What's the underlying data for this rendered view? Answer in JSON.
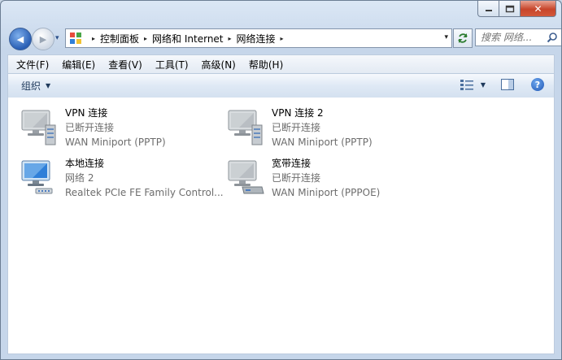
{
  "window": {
    "caption": {
      "minimize_icon": "minimize-icon",
      "maximize_icon": "maximize-icon",
      "close_label": "✕"
    }
  },
  "nav": {
    "back_glyph": "◀",
    "forward_glyph": "▶",
    "dropdown_glyph": "▾"
  },
  "address": {
    "crumbs": [
      "控制面板",
      "网络和 Internet",
      "网络连接"
    ],
    "arrow": "▸",
    "drop": "▾"
  },
  "search": {
    "placeholder": "搜索 网络..."
  },
  "menubar": {
    "items": [
      "文件(F)",
      "编辑(E)",
      "查看(V)",
      "工具(T)",
      "高级(N)",
      "帮助(H)"
    ]
  },
  "commandbar": {
    "organize_label": "组织",
    "organize_arrow": "▼",
    "views_arrow": "▼",
    "help_glyph": "?"
  },
  "connections": [
    {
      "name": "VPN 连接",
      "status": "已断开连接",
      "device": "WAN Miniport (PPTP)",
      "icon": "vpn-connection-icon"
    },
    {
      "name": "VPN 连接 2",
      "status": "已断开连接",
      "device": "WAN Miniport (PPTP)",
      "icon": "vpn-connection-icon"
    },
    {
      "name": "本地连接",
      "status": "网络  2",
      "device": "Realtek PCIe FE Family Control...",
      "icon": "lan-connection-icon"
    },
    {
      "name": "宽带连接",
      "status": "已断开连接",
      "device": "WAN Miniport (PPPOE)",
      "icon": "broadband-connection-icon"
    }
  ],
  "colors": {
    "accent": "#2a5fb5",
    "status_text": "#6d6d6d",
    "frame": "#c6d6ea"
  }
}
